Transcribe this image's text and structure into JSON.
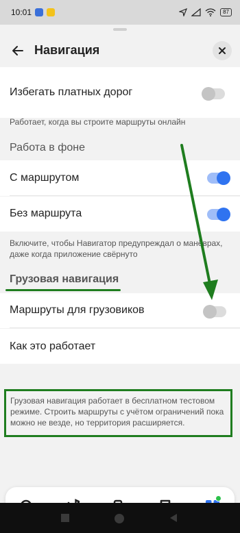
{
  "status_bar": {
    "time": "10:01",
    "battery": "87"
  },
  "header": {
    "title": "Навигация"
  },
  "settings": {
    "avoid_toll": {
      "label": "Избегать платных дорог",
      "enabled": false,
      "hint": "Работает, когда вы строите маршруты онлайн"
    },
    "background": {
      "section_title": "Работа в фоне",
      "with_route": {
        "label": "С маршрутом",
        "enabled": true
      },
      "without_route": {
        "label": "Без маршрута",
        "enabled": true
      },
      "hint": "Включите, чтобы Навигатор предупреждал о манёврах, даже когда приложение свёрнуто"
    },
    "truck": {
      "section_title": "Грузовая навигация",
      "routes": {
        "label": "Маршруты для грузовиков",
        "enabled": false
      },
      "how_it_works": "Как это работает",
      "hint": "Грузовая навигация работает в бесплатном тестовом режиме. Строить маршруты с учётом ограничений пока можно не везде, но территория расширяется."
    }
  },
  "bottom_nav": {
    "items": [
      "search-icon",
      "music-icon",
      "gas-station-icon",
      "bookmarks-icon",
      "services-grid-icon"
    ]
  },
  "colors": {
    "accent": "#2f73f0",
    "annotation_green": "#1f7d1f"
  }
}
